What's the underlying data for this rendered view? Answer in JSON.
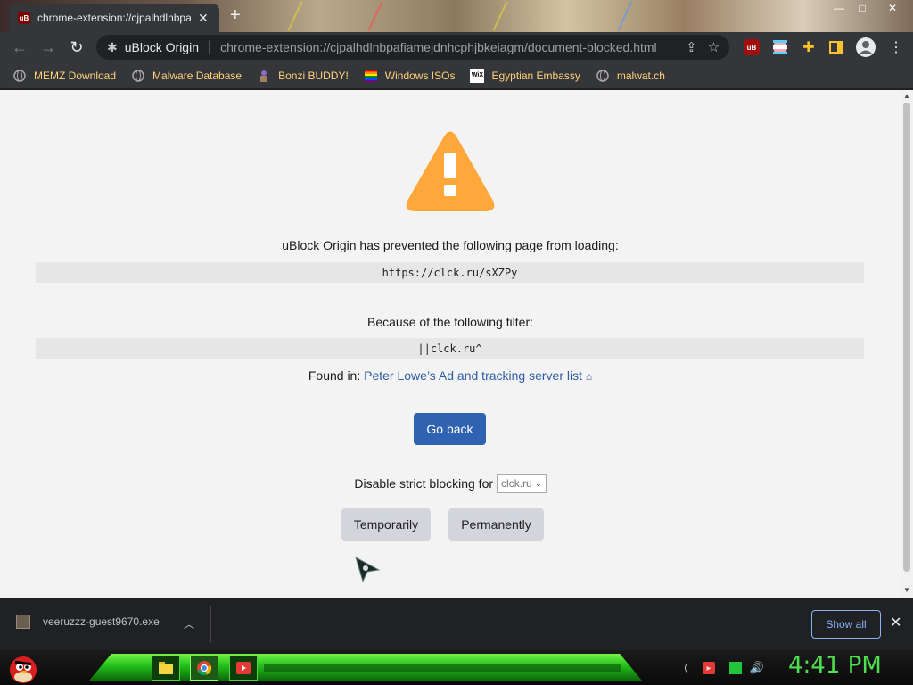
{
  "tab": {
    "title": "chrome-extension://cjpalhdlnbpafiamejdnhcphjbkeiagm/document-blocked.html",
    "favicon": "uB"
  },
  "window_buttons": {
    "minimize": "—",
    "maximize": "□",
    "close": "✕"
  },
  "omnibox": {
    "site_name": "uBlock Origin",
    "url": "chrome-extension://cjpalhdlnbpafiamejdnhcphjbkeiagm/document-blocked.html"
  },
  "bookmarks": [
    {
      "label": "MEMZ Download",
      "icon": "globe-icon"
    },
    {
      "label": "Malware Database",
      "icon": "globe-icon"
    },
    {
      "label": "Bonzi BUDDY!",
      "icon": "bonzi-icon"
    },
    {
      "label": "Windows ISOs",
      "icon": "rainbow-icon"
    },
    {
      "label": "Egyptian Embassy",
      "icon": "wix-icon"
    },
    {
      "label": "malwat.ch",
      "icon": "globe-icon"
    }
  ],
  "page": {
    "prevented_text": "uBlock Origin has prevented the following page from loading:",
    "blocked_url": "https://clck.ru/sXZPy",
    "filter_text": "Because of the following filter:",
    "filter": "||clck.ru^",
    "found_in_label": "Found in:",
    "found_in_link": "Peter Lowe’s Ad and tracking server list",
    "go_back": "Go back",
    "disable_label": "Disable strict blocking for",
    "disable_domain": "clck.ru",
    "temporarily": "Temporarily",
    "permanently": "Permanently"
  },
  "downloads": {
    "file_name": "veeruzzz-guest9670.exe",
    "show_all": "Show all"
  },
  "taskbar": {
    "clock": "4:41 PM"
  },
  "colors": {
    "warning": "#ffa73a",
    "go_back_bg": "#2f62b0",
    "link": "#2f5da8",
    "clock": "#4fe04f",
    "taskbar_glow": "#23c81a"
  }
}
